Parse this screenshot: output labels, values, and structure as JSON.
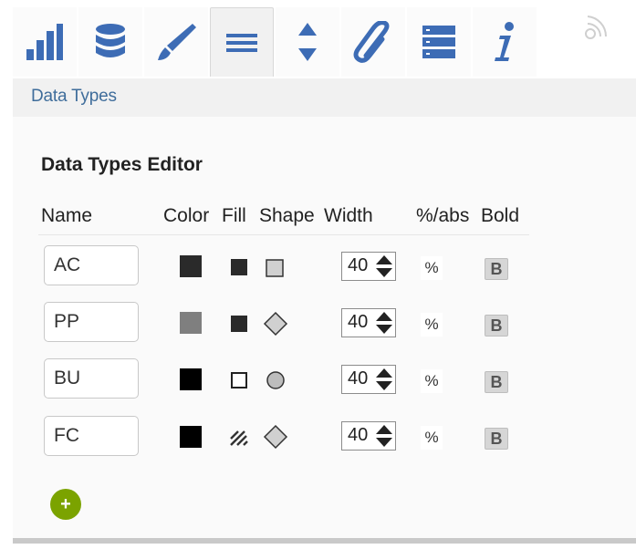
{
  "tabs": [
    {
      "icon": "bar-chart-icon",
      "active": false
    },
    {
      "icon": "database-icon",
      "active": false
    },
    {
      "icon": "brush-icon",
      "active": false
    },
    {
      "icon": "menu-lines-icon",
      "active": true
    },
    {
      "icon": "sort-arrows-icon",
      "active": false
    },
    {
      "icon": "paperclip-icon",
      "active": false
    },
    {
      "icon": "server-list-icon",
      "active": false
    },
    {
      "icon": "info-icon",
      "active": false
    }
  ],
  "section": {
    "title": "Data Types"
  },
  "editor": {
    "title": "Data Types Editor",
    "columns": {
      "name": "Name",
      "color": "Color",
      "fill": "Fill",
      "shape": "Shape",
      "width": "Width",
      "pct_abs": "%/abs",
      "bold": "Bold"
    },
    "rows": [
      {
        "name": "AC",
        "color": "#2a2a2a",
        "fill": "solid",
        "shape": "square",
        "width": "40",
        "unit": "%",
        "bold": "B"
      },
      {
        "name": "PP",
        "color": "#7f7f7f",
        "fill": "solid",
        "shape": "diamond",
        "width": "40",
        "unit": "%",
        "bold": "B"
      },
      {
        "name": "BU",
        "color": "#000000",
        "fill": "outline",
        "shape": "circle",
        "width": "40",
        "unit": "%",
        "bold": "B"
      },
      {
        "name": "FC",
        "color": "#000000",
        "fill": "hatched",
        "shape": "diamond",
        "width": "40",
        "unit": "%",
        "bold": "B"
      }
    ],
    "add_label": "+"
  },
  "colors": {
    "accent_blue": "#3d6cb5",
    "section_title": "#3f6d9b",
    "add_green": "#7ba300"
  }
}
